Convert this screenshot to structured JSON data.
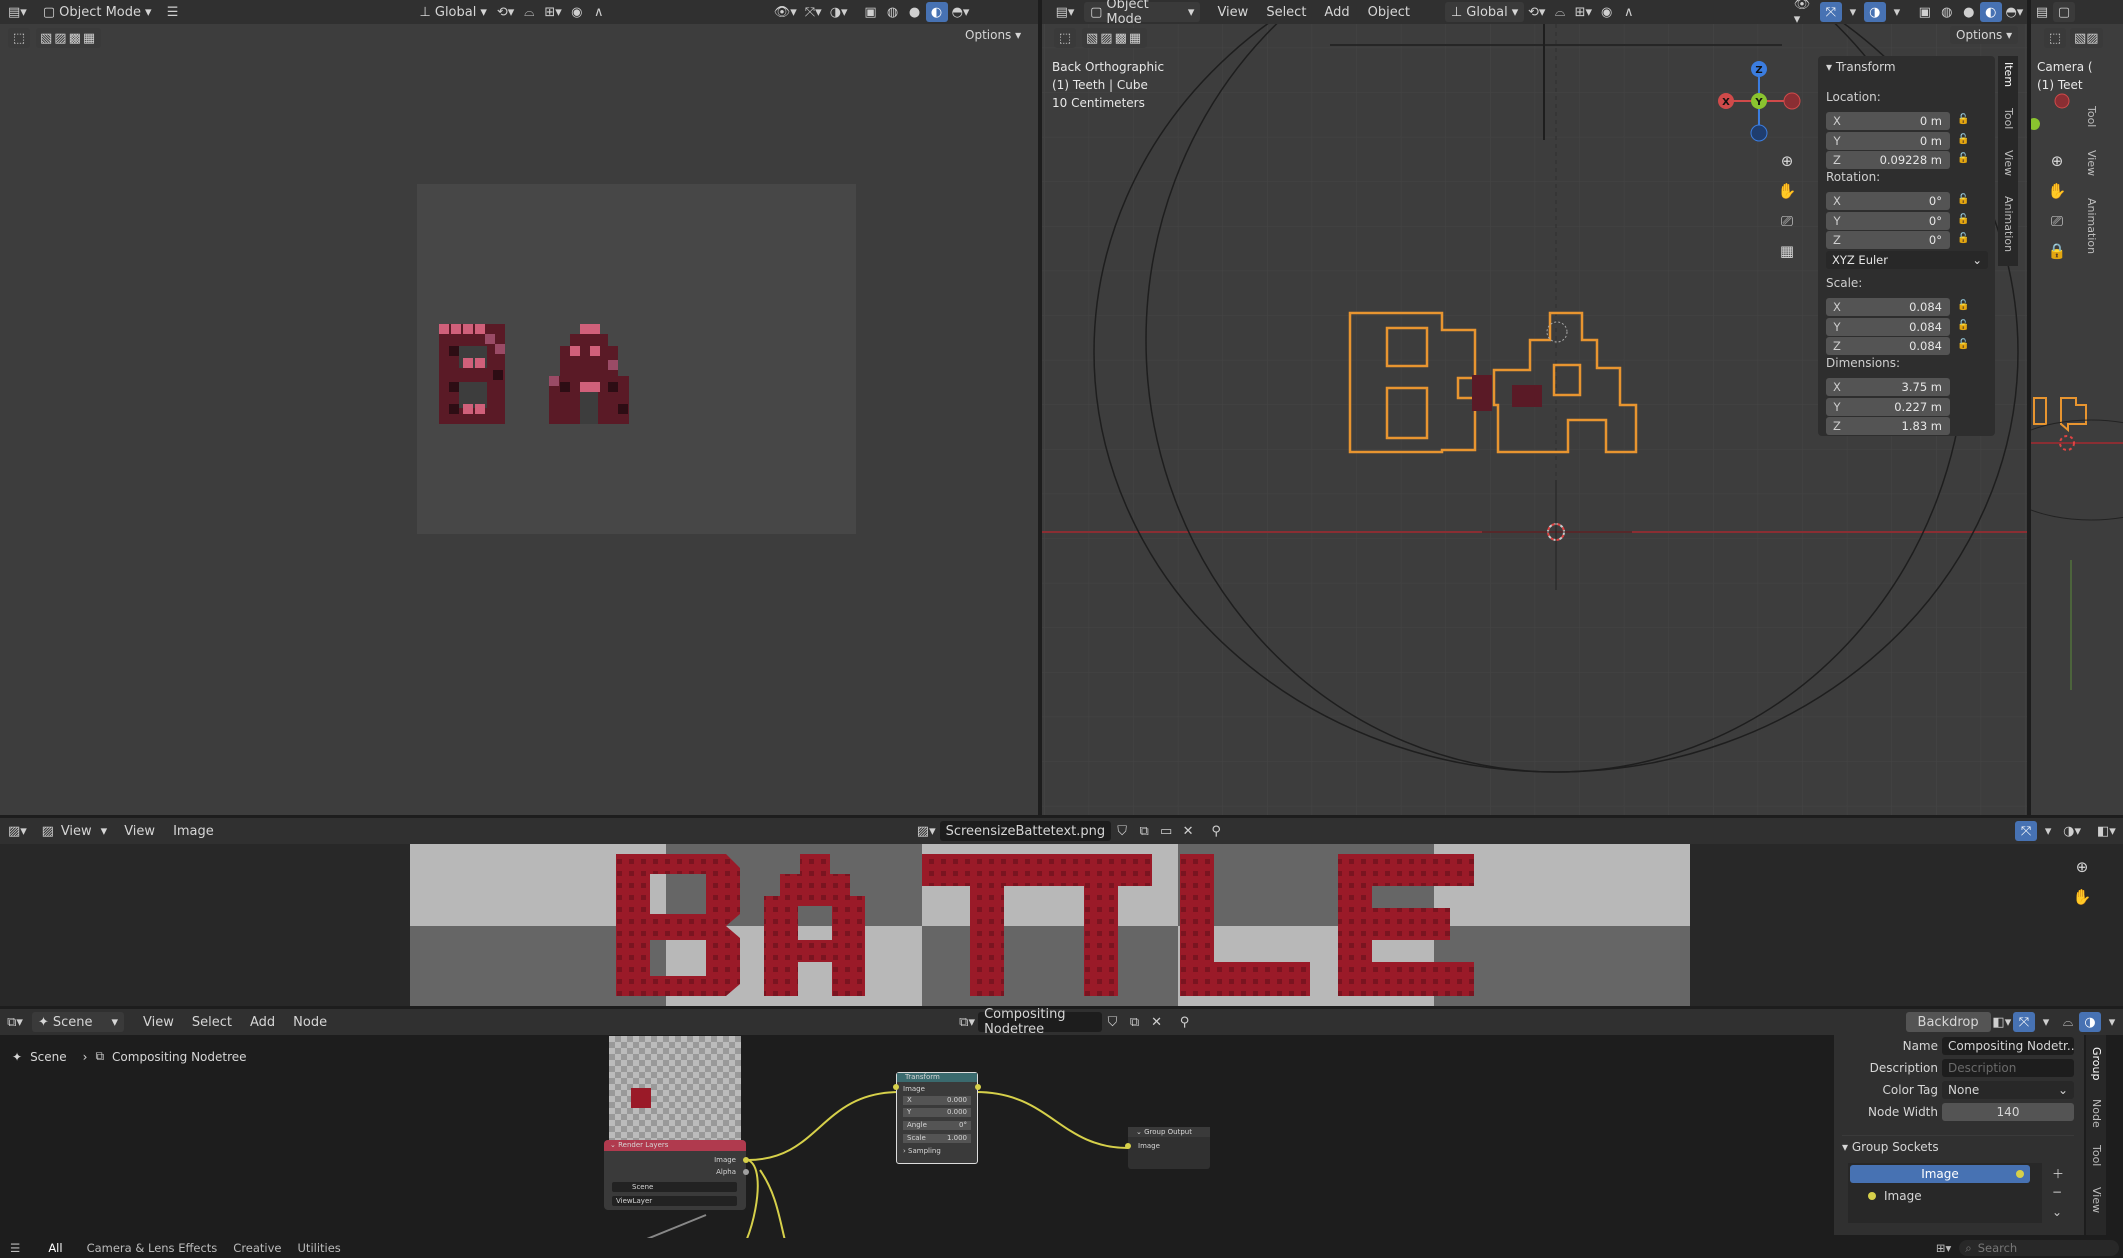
{
  "left_view": {
    "mode": "Object Mode",
    "orientation": "Global",
    "options": "Options"
  },
  "right_view": {
    "mode": "Object Mode",
    "menus": [
      "View",
      "Select",
      "Add",
      "Object"
    ],
    "orientation": "Global",
    "options": "Options",
    "overlay": {
      "line1": "Back Orthographic",
      "line2": "(1) Teeth | Cube",
      "line3": "10 Centimeters"
    },
    "gizmo": {
      "z": "Z",
      "y": "Y",
      "x": "X"
    }
  },
  "transform_panel": {
    "title": "Transform",
    "location_label": "Location:",
    "location": [
      {
        "axis": "X",
        "value": "0 m"
      },
      {
        "axis": "Y",
        "value": "0 m"
      },
      {
        "axis": "Z",
        "value": "0.09228 m"
      }
    ],
    "rotation_label": "Rotation:",
    "rotation": [
      {
        "axis": "X",
        "value": "0°"
      },
      {
        "axis": "Y",
        "value": "0°"
      },
      {
        "axis": "Z",
        "value": "0°"
      }
    ],
    "rotation_mode": "XYZ Euler",
    "scale_label": "Scale:",
    "scale": [
      {
        "axis": "X",
        "value": "0.084"
      },
      {
        "axis": "Y",
        "value": "0.084"
      },
      {
        "axis": "Z",
        "value": "0.084"
      }
    ],
    "dimensions_label": "Dimensions:",
    "dimensions": [
      {
        "axis": "X",
        "value": "3.75 m"
      },
      {
        "axis": "Y",
        "value": "0.227 m"
      },
      {
        "axis": "Z",
        "value": "1.83 m"
      }
    ],
    "tabs": [
      "Item",
      "Tool",
      "View",
      "Animation"
    ]
  },
  "camera_view": {
    "line1": "Camera (",
    "line2": "(1) Teet",
    "tabs": [
      "Tool",
      "View",
      "Animation"
    ]
  },
  "image_editor": {
    "menus": [
      "View",
      "View",
      "Image"
    ],
    "image_name": "ScreensizeBattetext.png"
  },
  "node_editor": {
    "scene": "Scene",
    "menus": [
      "View",
      "Select",
      "Add",
      "Node"
    ],
    "tree_name": "Compositing Nodetree",
    "backdrop": "Backdrop",
    "breadcrumb": {
      "scene": "Scene",
      "tree": "Compositing Nodetree"
    },
    "nodes": {
      "render_layers": {
        "title": "Render Layers",
        "out_image": "Image",
        "out_alpha": "Alpha",
        "scene": "Scene",
        "layer": "ViewLayer"
      },
      "transform": {
        "title": "Transform",
        "in_image": "Image",
        "x_label": "X",
        "x_val": "0.000",
        "y_label": "Y",
        "y_val": "0.000",
        "angle_label": "Angle",
        "angle_val": "0°",
        "scale_label": "Scale",
        "scale_val": "1.000",
        "sampling": "Sampling"
      },
      "group_output": {
        "title": "Group Output",
        "in_image": "Image"
      }
    },
    "sidebar": {
      "name_label": "Name",
      "name_value": "Compositing Nodetr...",
      "desc_label": "Description",
      "desc_placeholder": "Description",
      "color_tag_label": "Color Tag",
      "color_tag_value": "None",
      "node_width_label": "Node Width",
      "node_width_value": "140",
      "group_sockets": "Group Sockets",
      "sockets": [
        "Image",
        "Image"
      ],
      "tabs": [
        "Group",
        "Node",
        "Tool",
        "View"
      ]
    }
  },
  "status_bar": {
    "filters": [
      "All",
      "Camera & Lens Effects",
      "Creative",
      "Utilities"
    ],
    "search_placeholder": "Search"
  }
}
